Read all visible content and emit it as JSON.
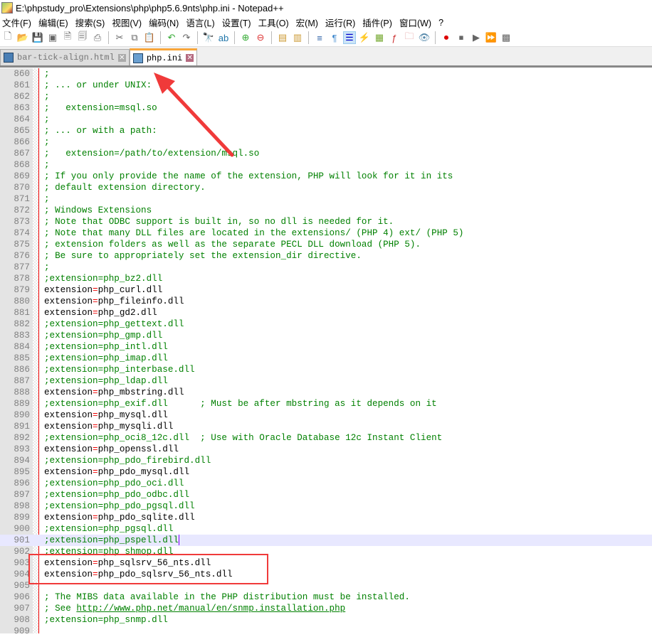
{
  "title": "E:\\phpstudy_pro\\Extensions\\php\\php5.6.9nts\\php.ini - Notepad++",
  "menu": [
    "文件(F)",
    "编辑(E)",
    "搜索(S)",
    "视图(V)",
    "编码(N)",
    "语言(L)",
    "设置(T)",
    "工具(O)",
    "宏(M)",
    "运行(R)",
    "插件(P)",
    "窗口(W)",
    "?"
  ],
  "tabs": [
    {
      "label": "bar-tick-align.html",
      "active": false
    },
    {
      "label": "php.ini",
      "active": true
    }
  ],
  "current_line": 901,
  "lines": [
    {
      "n": "860",
      "t": ";",
      "k": "c"
    },
    {
      "n": "861",
      "t": "; ... or under UNIX:",
      "k": "c"
    },
    {
      "n": "862",
      "t": ";",
      "k": "c"
    },
    {
      "n": "863",
      "t": ";   extension=msql.so",
      "k": "c"
    },
    {
      "n": "864",
      "t": ";",
      "k": "c"
    },
    {
      "n": "865",
      "t": "; ... or with a path:",
      "k": "c"
    },
    {
      "n": "866",
      "t": ";",
      "k": "c"
    },
    {
      "n": "867",
      "t": ";   extension=/path/to/extension/msql.so",
      "k": "c"
    },
    {
      "n": "868",
      "t": ";",
      "k": "c"
    },
    {
      "n": "869",
      "t": "; If you only provide the name of the extension, PHP will look for it in its",
      "k": "c"
    },
    {
      "n": "870",
      "t": "; default extension directory.",
      "k": "c"
    },
    {
      "n": "871",
      "t": ";",
      "k": "c"
    },
    {
      "n": "872",
      "t": "; Windows Extensions",
      "k": "c"
    },
    {
      "n": "873",
      "t": "; Note that ODBC support is built in, so no dll is needed for it.",
      "k": "c"
    },
    {
      "n": "874",
      "t": "; Note that many DLL files are located in the extensions/ (PHP 4) ext/ (PHP 5)",
      "k": "c"
    },
    {
      "n": "875",
      "t": "; extension folders as well as the separate PECL DLL download (PHP 5).",
      "k": "c"
    },
    {
      "n": "876",
      "t": "; Be sure to appropriately set the extension_dir directive.",
      "k": "c"
    },
    {
      "n": "877",
      "t": ";",
      "k": "c"
    },
    {
      "n": "878",
      "t": ";extension=php_bz2.dll",
      "k": "c"
    },
    {
      "n": "879",
      "t": "extension=php_curl.dll",
      "k": "k"
    },
    {
      "n": "880",
      "t": "extension=php_fileinfo.dll",
      "k": "k"
    },
    {
      "n": "881",
      "t": "extension=php_gd2.dll",
      "k": "k"
    },
    {
      "n": "882",
      "t": ";extension=php_gettext.dll",
      "k": "c"
    },
    {
      "n": "883",
      "t": ";extension=php_gmp.dll",
      "k": "c"
    },
    {
      "n": "884",
      "t": ";extension=php_intl.dll",
      "k": "c"
    },
    {
      "n": "885",
      "t": ";extension=php_imap.dll",
      "k": "c"
    },
    {
      "n": "886",
      "t": ";extension=php_interbase.dll",
      "k": "c"
    },
    {
      "n": "887",
      "t": ";extension=php_ldap.dll",
      "k": "c"
    },
    {
      "n": "888",
      "t": "extension=php_mbstring.dll",
      "k": "k"
    },
    {
      "n": "889",
      "t": ";extension=php_exif.dll      ; Must be after mbstring as it depends on it",
      "k": "c"
    },
    {
      "n": "890",
      "t": "extension=php_mysql.dll",
      "k": "k"
    },
    {
      "n": "891",
      "t": "extension=php_mysqli.dll",
      "k": "k"
    },
    {
      "n": "892",
      "t": ";extension=php_oci8_12c.dll  ; Use with Oracle Database 12c Instant Client",
      "k": "c"
    },
    {
      "n": "893",
      "t": "extension=php_openssl.dll",
      "k": "k"
    },
    {
      "n": "894",
      "t": ";extension=php_pdo_firebird.dll",
      "k": "c"
    },
    {
      "n": "895",
      "t": "extension=php_pdo_mysql.dll",
      "k": "k"
    },
    {
      "n": "896",
      "t": ";extension=php_pdo_oci.dll",
      "k": "c"
    },
    {
      "n": "897",
      "t": ";extension=php_pdo_odbc.dll",
      "k": "c"
    },
    {
      "n": "898",
      "t": ";extension=php_pdo_pgsql.dll",
      "k": "c"
    },
    {
      "n": "899",
      "t": "extension=php_pdo_sqlite.dll",
      "k": "k"
    },
    {
      "n": "900",
      "t": ";extension=php_pgsql.dll",
      "k": "c"
    },
    {
      "n": "901",
      "t": ";extension=php_pspell.dll",
      "k": "c"
    },
    {
      "n": "902",
      "t": ";extension=php_shmop.dll",
      "k": "c"
    },
    {
      "n": "903",
      "t": "extension=php_sqlsrv_56_nts.dll",
      "k": "k"
    },
    {
      "n": "904",
      "t": "extension=php_pdo_sqlsrv_56_nts.dll",
      "k": "k"
    },
    {
      "n": "905",
      "t": "",
      "k": "c"
    },
    {
      "n": "906",
      "t": "; The MIBS data available in the PHP distribution must be installed.",
      "k": "c"
    },
    {
      "n": "907",
      "t": "; See ",
      "url": "http://www.php.net/manual/en/snmp.installation.php",
      "k": "c"
    },
    {
      "n": "908",
      "t": ";extension=php_snmp.dll",
      "k": "c"
    },
    {
      "n": "909",
      "t": "",
      "k": "c"
    }
  ],
  "colors": {
    "comment": "#008000",
    "operator": "#ff0000",
    "highlight": "#f03a3a"
  }
}
